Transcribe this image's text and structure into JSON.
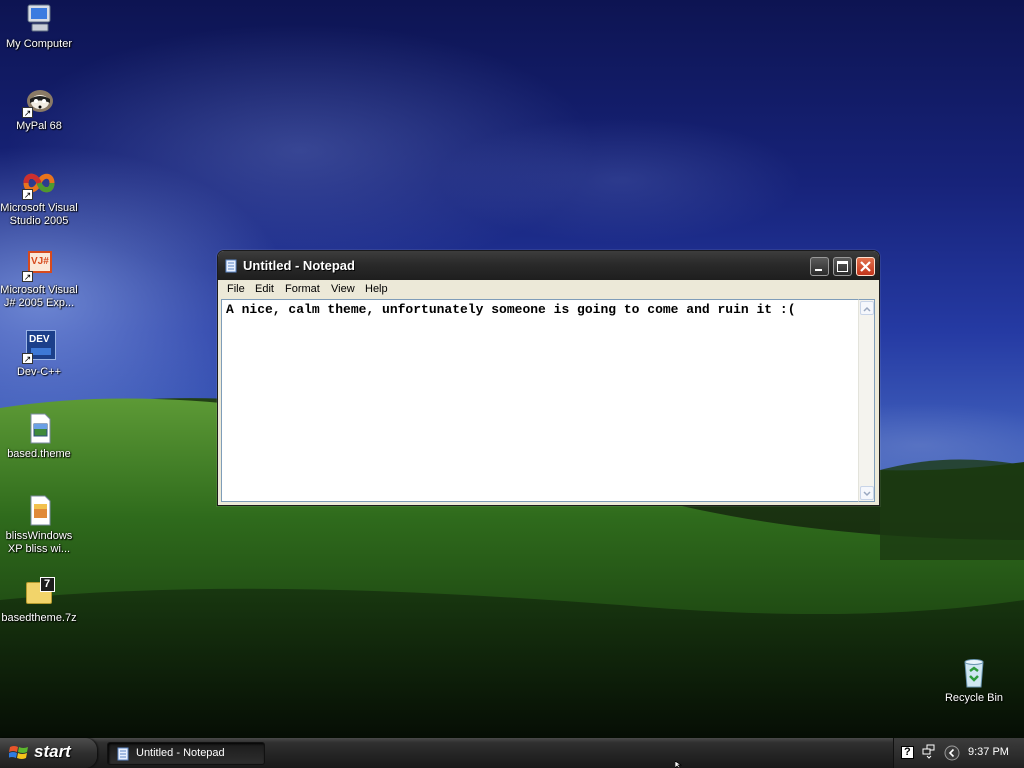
{
  "desktop": {
    "icons": [
      {
        "label": "My Computer",
        "icon": "my-computer-icon"
      },
      {
        "label": "MyPal 68",
        "icon": "mypal-icon"
      },
      {
        "label": "Microsoft Visual\nStudio 2005",
        "icon": "visual-studio-icon"
      },
      {
        "label": "Microsoft Visual\nJ# 2005 Exp...",
        "icon": "visual-jsharp-icon"
      },
      {
        "label": "Dev-C++",
        "icon": "dev-cpp-icon"
      },
      {
        "label": "based.theme",
        "icon": "theme-file-icon"
      },
      {
        "label": "blissWindows\nXP bliss wi...",
        "icon": "image-file-icon"
      },
      {
        "label": "basedtheme.7z",
        "icon": "7z-archive-icon"
      },
      {
        "label": "Recycle Bin",
        "icon": "recycle-bin-icon"
      }
    ],
    "icon_badges": {
      "vj": "VJ#",
      "dev": "DEV",
      "seven": "7"
    }
  },
  "notepad": {
    "title": "Untitled - Notepad",
    "menu": [
      "File",
      "Edit",
      "Format",
      "View",
      "Help"
    ],
    "content": "A nice, calm theme, unfortunately someone is going to come and ruin it :("
  },
  "taskbar": {
    "start_label": "start",
    "tasks": [
      {
        "label": "Untitled - Notepad"
      }
    ],
    "tray_help": "?",
    "clock": "9:37 PM"
  },
  "colors": {
    "close_button": "#c2341b",
    "title_bar": "#2a2a2a",
    "taskbar": "#232323"
  }
}
